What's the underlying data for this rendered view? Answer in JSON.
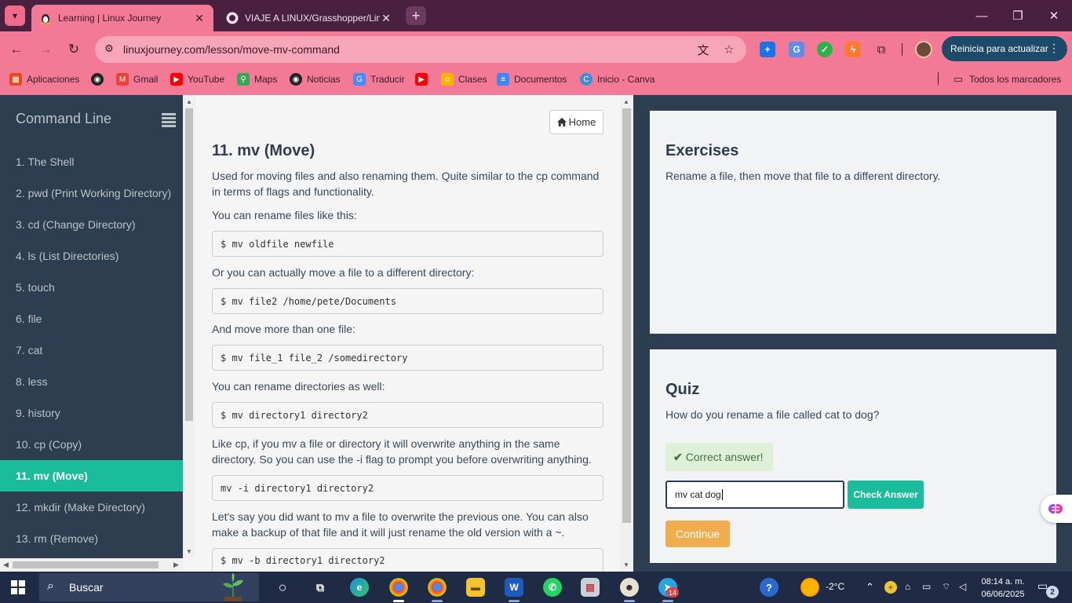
{
  "browser": {
    "tabs": [
      {
        "title": "Learning | Linux Journey",
        "active": true
      },
      {
        "title": "VIAJE A LINUX/Grasshopper/Linux",
        "active": false
      }
    ],
    "url": "linuxjourney.com/lesson/move-mv-command",
    "update_button": "Reinicia para actualizar",
    "bookmarks": [
      "Aplicaciones",
      "Gmail",
      "YouTube",
      "Maps",
      "Noticias",
      "Traducir",
      "Clases",
      "Documentos",
      "Inicio - Canva"
    ],
    "all_bookmarks": "Todos los marcadores",
    "colors": {
      "tabbar": "#4a2040",
      "toolbar": "#f27a96",
      "accent": "#1e4a6a"
    }
  },
  "sidebar": {
    "title": "Command Line",
    "items": [
      {
        "label": "1. The Shell"
      },
      {
        "label": "2. pwd (Print Working Directory)"
      },
      {
        "label": "3. cd (Change Directory)"
      },
      {
        "label": "4. ls (List Directories)"
      },
      {
        "label": "5. touch"
      },
      {
        "label": "6. file"
      },
      {
        "label": "7. cat"
      },
      {
        "label": "8. less"
      },
      {
        "label": "9. history"
      },
      {
        "label": "10. cp (Copy)"
      },
      {
        "label": "11. mv (Move)",
        "active": true
      },
      {
        "label": "12. mkdir (Make Directory)"
      },
      {
        "label": "13. rm (Remove)"
      }
    ]
  },
  "lesson": {
    "home_label": "Home",
    "title": "11. mv (Move)",
    "p1": "Used for moving files and also renaming them. Quite similar to the cp command in terms of flags and functionality.",
    "p2": "You can rename files like this:",
    "code1": "$ mv oldfile newfile",
    "p3": "Or you can actually move a file to a different directory:",
    "code2": "$ mv file2 /home/pete/Documents",
    "p4": "And move more than one file:",
    "code3": "$ mv file_1 file_2 /somedirectory",
    "p5": "You can rename directories as well:",
    "code4": "$ mv directory1 directory2",
    "p6": "Like cp, if you mv a file or directory it will overwrite anything in the same directory. So you can use the -i flag to prompt you before overwriting anything.",
    "code5": "mv -i directory1 directory2",
    "p7": "Let's say you did want to mv a file to overwrite the previous one. You can also make a backup of that file and it will just rename the old version with a ~.",
    "code6": "$ mv -b directory1 directory2"
  },
  "exercises": {
    "title": "Exercises",
    "text": "Rename a file, then move that file to a different directory."
  },
  "quiz": {
    "title": "Quiz",
    "question": "How do you rename a file called cat to dog?",
    "status": "Correct answer!",
    "answer_value": "mv cat dog",
    "check_label": "Check Answer",
    "continue_label": "Continue",
    "colors": {
      "teal": "#1abc9c",
      "orange": "#f0ad4e",
      "success_bg": "#dff0d8"
    }
  },
  "taskbar": {
    "search_label": "Buscar",
    "weather": "-2°C",
    "time": "08:14 a. m.",
    "date": "06/06/2025",
    "telegram_badge": "14",
    "notifications": "2"
  }
}
